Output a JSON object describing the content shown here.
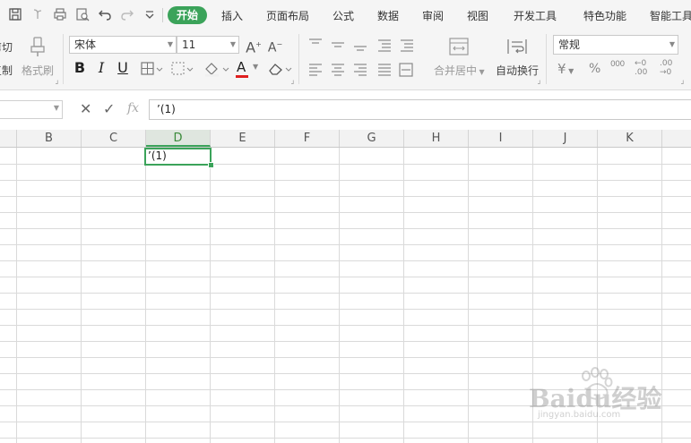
{
  "quick_access": [
    "save-icon",
    "redo-icon",
    "print-icon",
    "print-preview-icon",
    "undo-icon",
    "redo-icon",
    "more-dropdown-icon"
  ],
  "tabs": {
    "active": "开始",
    "items": [
      "插入",
      "页面布局",
      "公式",
      "数据",
      "审阅",
      "视图",
      "开发工具",
      "特色功能",
      "智能工具"
    ]
  },
  "ribbon": {
    "cut_label": "剪切",
    "copy_label": "复制",
    "format_painter_label": "格式刷",
    "font_name": "宋体",
    "font_size": "11",
    "bold": "B",
    "italic": "I",
    "underline": "U",
    "font_color_glyph": "A",
    "merge_label": "合并居中",
    "wrap_label": "自动换行",
    "number_format": "常规",
    "currency_glyph": "¥",
    "percent_glyph": "%",
    "thousands_glyph": "000",
    "dec_inc_glyph": "←0 .00",
    "dec_dec_glyph": ".00 →0",
    "accent_color": "#3ba35a",
    "font_color_bar": "#e02020"
  },
  "formula_bar": {
    "cancel_glyph": "✕",
    "confirm_glyph": "✓",
    "fx_label": "fx",
    "content": "’(1)"
  },
  "sheet": {
    "columns": [
      "B",
      "C",
      "D",
      "E",
      "F",
      "G",
      "H",
      "I",
      "J",
      "K"
    ],
    "active_column": "D",
    "active_cell_value": "’(1)"
  },
  "watermark": {
    "brand": "Baidu经验",
    "url": "jingyan.baidu.com"
  }
}
